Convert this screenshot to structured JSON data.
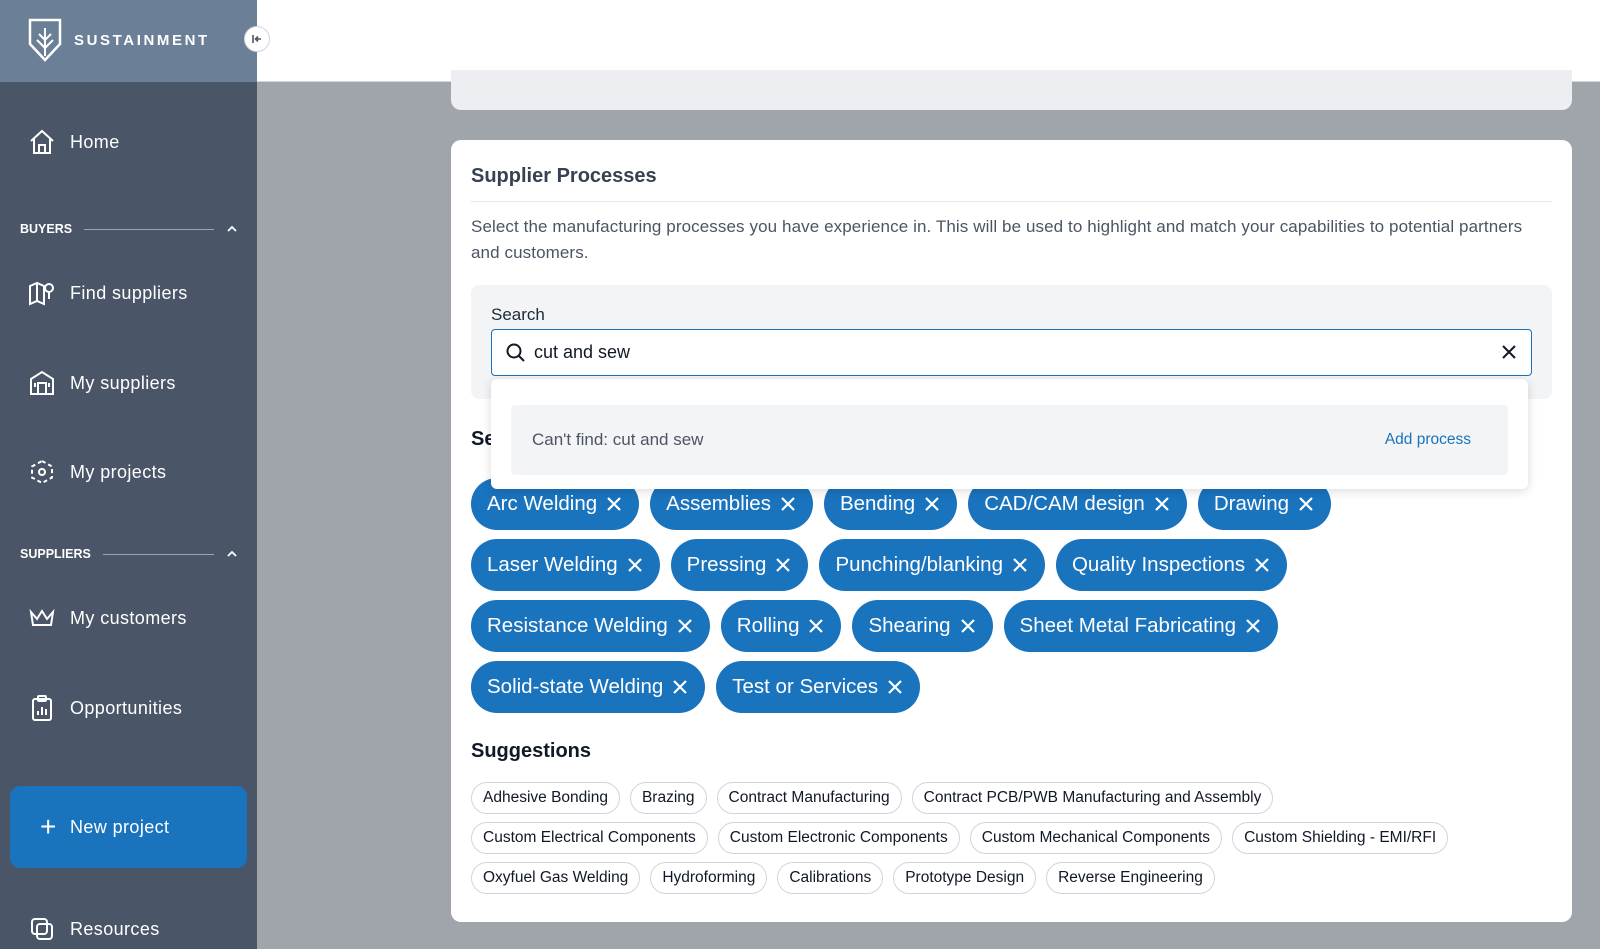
{
  "brand": {
    "name": "SUSTAINMENT"
  },
  "sidebar": {
    "home": "Home",
    "sections": {
      "buyers": "BUYERS",
      "suppliers": "SUPPLIERS"
    },
    "buyers_items": [
      "Find suppliers",
      "My suppliers",
      "My projects"
    ],
    "suppliers_items": [
      "My customers",
      "Opportunities"
    ],
    "new_project": "New project",
    "resources": "Resources"
  },
  "card": {
    "title": "Supplier Processes",
    "description": "Select the manufacturing processes you have experience in. This will be used to highlight and match your capabilities to potential partners and customers.",
    "search_label": "Search",
    "search_value": "cut and sew",
    "dropdown": {
      "cant_find": "Can't find: cut and sew",
      "add_process": "Add process"
    },
    "selected_heading": "Se",
    "selected": [
      [
        "Arc Welding",
        "Assemblies",
        "Bending",
        "CAD/CAM design",
        "Drawing"
      ],
      [
        "Laser Welding",
        "Pressing",
        "Punching/blanking",
        "Quality Inspections"
      ],
      [
        "Resistance Welding",
        "Rolling",
        "Shearing",
        "Sheet Metal Fabricating"
      ],
      [
        "Solid-state Welding",
        "Test or Services"
      ]
    ],
    "suggestions_heading": "Suggestions",
    "suggestions": [
      [
        "Adhesive Bonding",
        "Brazing",
        "Contract Manufacturing",
        "Contract PCB/PWB Manufacturing and Assembly"
      ],
      [
        "Custom Electrical Components",
        "Custom Electronic Components",
        "Custom Mechanical Components",
        "Custom Shielding - EMI/RFI"
      ],
      [
        "Oxyfuel Gas Welding",
        "Hydroforming",
        "Calibrations",
        "Prototype Design",
        "Reverse Engineering"
      ]
    ]
  },
  "colors": {
    "accent": "#1a73bd",
    "sidebar": "#4a5568",
    "brand_bar": "#6b7f96"
  }
}
